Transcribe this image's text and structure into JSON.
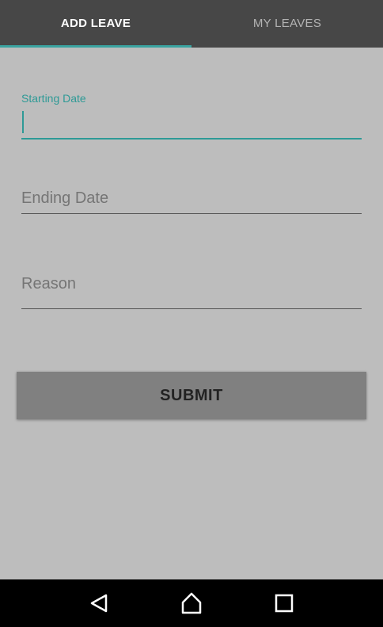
{
  "tabs": [
    {
      "label": "ADD LEAVE",
      "active": true
    },
    {
      "label": "MY LEAVES",
      "active": false
    }
  ],
  "form": {
    "starting_date": {
      "label": "Starting Date",
      "value": ""
    },
    "ending_date": {
      "placeholder": "Ending Date",
      "value": ""
    },
    "reason": {
      "placeholder": "Reason",
      "value": ""
    },
    "submit_label": "SUBMIT"
  },
  "navbar": {
    "icons": [
      "back-icon",
      "home-icon",
      "recents-icon"
    ]
  },
  "colors": {
    "accent": "#2e9a96",
    "tabbar": "#474747",
    "background": "#bdbdbd",
    "button": "#808080"
  }
}
